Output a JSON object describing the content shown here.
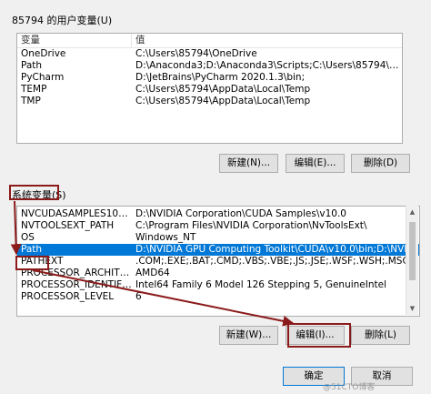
{
  "user_vars": {
    "group_label": "85794 的用户变量(U)",
    "headers": [
      "变量",
      "值"
    ],
    "rows": [
      [
        "OneDrive",
        "C:\\Users\\85794\\OneDrive"
      ],
      [
        "Path",
        "D:\\Anaconda3;D:\\Anaconda3\\Scripts;C:\\Users\\85794\\AppData\\Loc..."
      ],
      [
        "PyCharm",
        "D:\\JetBrains\\PyCharm 2020.1.3\\bin;"
      ],
      [
        "TEMP",
        "C:\\Users\\85794\\AppData\\Local\\Temp"
      ],
      [
        "TMP",
        "C:\\Users\\85794\\AppData\\Local\\Temp"
      ]
    ],
    "buttons": {
      "new": "新建(N)...",
      "edit": "编辑(E)...",
      "delete": "删除(D)"
    }
  },
  "system_vars": {
    "group_label": "系统变量(S)",
    "headers": [
      "变量",
      "值"
    ],
    "rows": [
      [
        "NVCUDASAMPLES10_0_RO...",
        "D:\\NVIDIA Corporation\\CUDA Samples\\v10.0"
      ],
      [
        "NVTOOLSEXT_PATH",
        "C:\\Program Files\\NVIDIA Corporation\\NvToolsExt\\"
      ],
      [
        "OS",
        "Windows_NT"
      ],
      [
        "Path",
        "D:\\NVIDIA GPU Computing Toolkit\\CUDA\\v10.0\\bin;D:\\NVIDIA GP..."
      ],
      [
        "PATHEXT",
        ".COM;.EXE;.BAT;.CMD;.VBS;.VBE;.JS;.JSE;.WSF;.WSH;.MSC"
      ],
      [
        "PROCESSOR_ARCHITECTURE",
        "AMD64"
      ],
      [
        "PROCESSOR_IDENTIFIER",
        "Intel64 Family 6 Model 126 Stepping 5, GenuineIntel"
      ],
      [
        "PROCESSOR_LEVEL",
        "6"
      ]
    ],
    "selected_index": 3,
    "buttons": {
      "new": "新建(W)...",
      "edit": "编辑(I)...",
      "delete": "删除(L)"
    }
  },
  "footer": {
    "ok": "确定",
    "cancel": "取消"
  },
  "watermark": "@51CTO博客",
  "colors": {
    "selection": "#0078d7",
    "annotation": "#8b1a1a"
  }
}
